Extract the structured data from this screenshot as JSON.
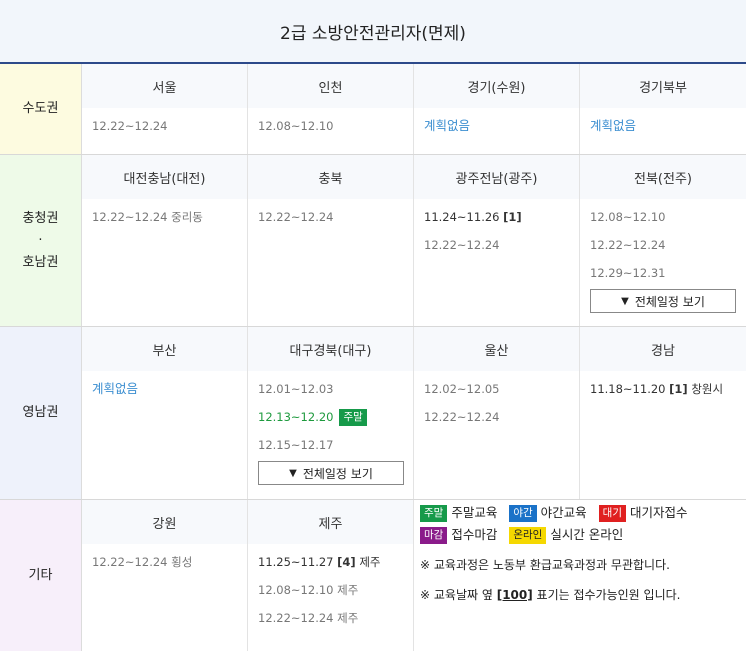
{
  "title": "2급 소방안전관리자(면제)",
  "buttons": {
    "full_schedule": "전체일정 보기"
  },
  "rows": {
    "capital": {
      "region": "수도권",
      "cells": [
        {
          "name": "서울",
          "dates": [
            "12.22~12.24"
          ]
        },
        {
          "name": "인천",
          "dates": [
            "12.08~12.10"
          ]
        },
        {
          "name": "경기(수원)",
          "status": "계획없음"
        },
        {
          "name": "경기북부",
          "status": "계획없음"
        }
      ]
    },
    "central": {
      "region_top": "충청권",
      "region_mid": "·",
      "region_bottom": "호남권",
      "cells": [
        {
          "name": "대전충남(대전)",
          "dates": [
            "12.22~12.24 중리동"
          ]
        },
        {
          "name": "충북",
          "dates": [
            "12.22~12.24"
          ]
        },
        {
          "name": "광주전남(광주)",
          "date1": "11.24~11.26",
          "date1_count": "[1]",
          "date2": "12.22~12.24"
        },
        {
          "name": "전북(전주)",
          "dates": [
            "12.08~12.10",
            "12.22~12.24",
            "12.29~12.31"
          ]
        }
      ]
    },
    "southeast": {
      "region": "영남권",
      "cells": [
        {
          "name": "부산",
          "status": "계획없음"
        },
        {
          "name": "대구경북(대구)",
          "date1": "12.01~12.03",
          "date2": "12.13~12.20",
          "date2_badge": "주말",
          "date3": "12.15~12.17"
        },
        {
          "name": "울산",
          "dates": [
            "12.02~12.05",
            "12.22~12.24"
          ]
        },
        {
          "name": "경남",
          "date1": "11.18~11.20",
          "date1_count": "[1]",
          "date1_place": "창원시"
        }
      ]
    },
    "other": {
      "region": "기타",
      "cells": [
        {
          "name": "강원",
          "dates": [
            "12.22~12.24 횡성"
          ]
        },
        {
          "name": "제주",
          "date1": "11.25~11.27",
          "date1_count": "[4]",
          "date1_place": "제주",
          "date2": "12.08~12.10 제주",
          "date3": "12.22~12.24 제주"
        }
      ]
    }
  },
  "legend": {
    "weekend_badge": "주말",
    "weekend_label": "주말교육",
    "night_badge": "야간",
    "night_label": "야간교육",
    "wait_badge": "대기",
    "wait_label": "대기자접수",
    "closed_badge": "마감",
    "closed_label": "접수마감",
    "online_badge": "온라인",
    "online_label": "실시간 온라인",
    "note1": "※ 교육과정은 노동부 환급교육과정과 무관합니다.",
    "note2_pre": "※ 교육날짜 옆 ",
    "note2_count": "[100]",
    "note2_post": " 표기는 접수가능인원 입니다."
  },
  "colors": {
    "header_bg": "#f2f6fb",
    "header_border": "#2d4a8a",
    "region_capital": "#fdfbe0",
    "region_central": "#eefae8",
    "region_southeast": "#eef2fb",
    "region_other": "#f7effa",
    "link_blue": "#3d8fd1",
    "weekend_green": "#169a4a"
  }
}
